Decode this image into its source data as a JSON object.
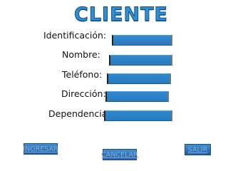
{
  "title": "CLIENTE",
  "form": {
    "fields": [
      {
        "label": "Identificación:",
        "value": ""
      },
      {
        "label": "Nombre:",
        "value": ""
      },
      {
        "label": "Teléfono:",
        "value": ""
      },
      {
        "label": "Dirección:",
        "value": ""
      },
      {
        "label": "Dependencia:",
        "value": ""
      }
    ]
  },
  "buttons": {
    "ingresar": "INGRESAR",
    "cancelar": "CANCELAR",
    "salir": "SALIR"
  },
  "colors": {
    "title": "#2f8fd2",
    "field": "#2a7abd",
    "button": "#1e60a5",
    "button_text": "#8aa6d8"
  }
}
